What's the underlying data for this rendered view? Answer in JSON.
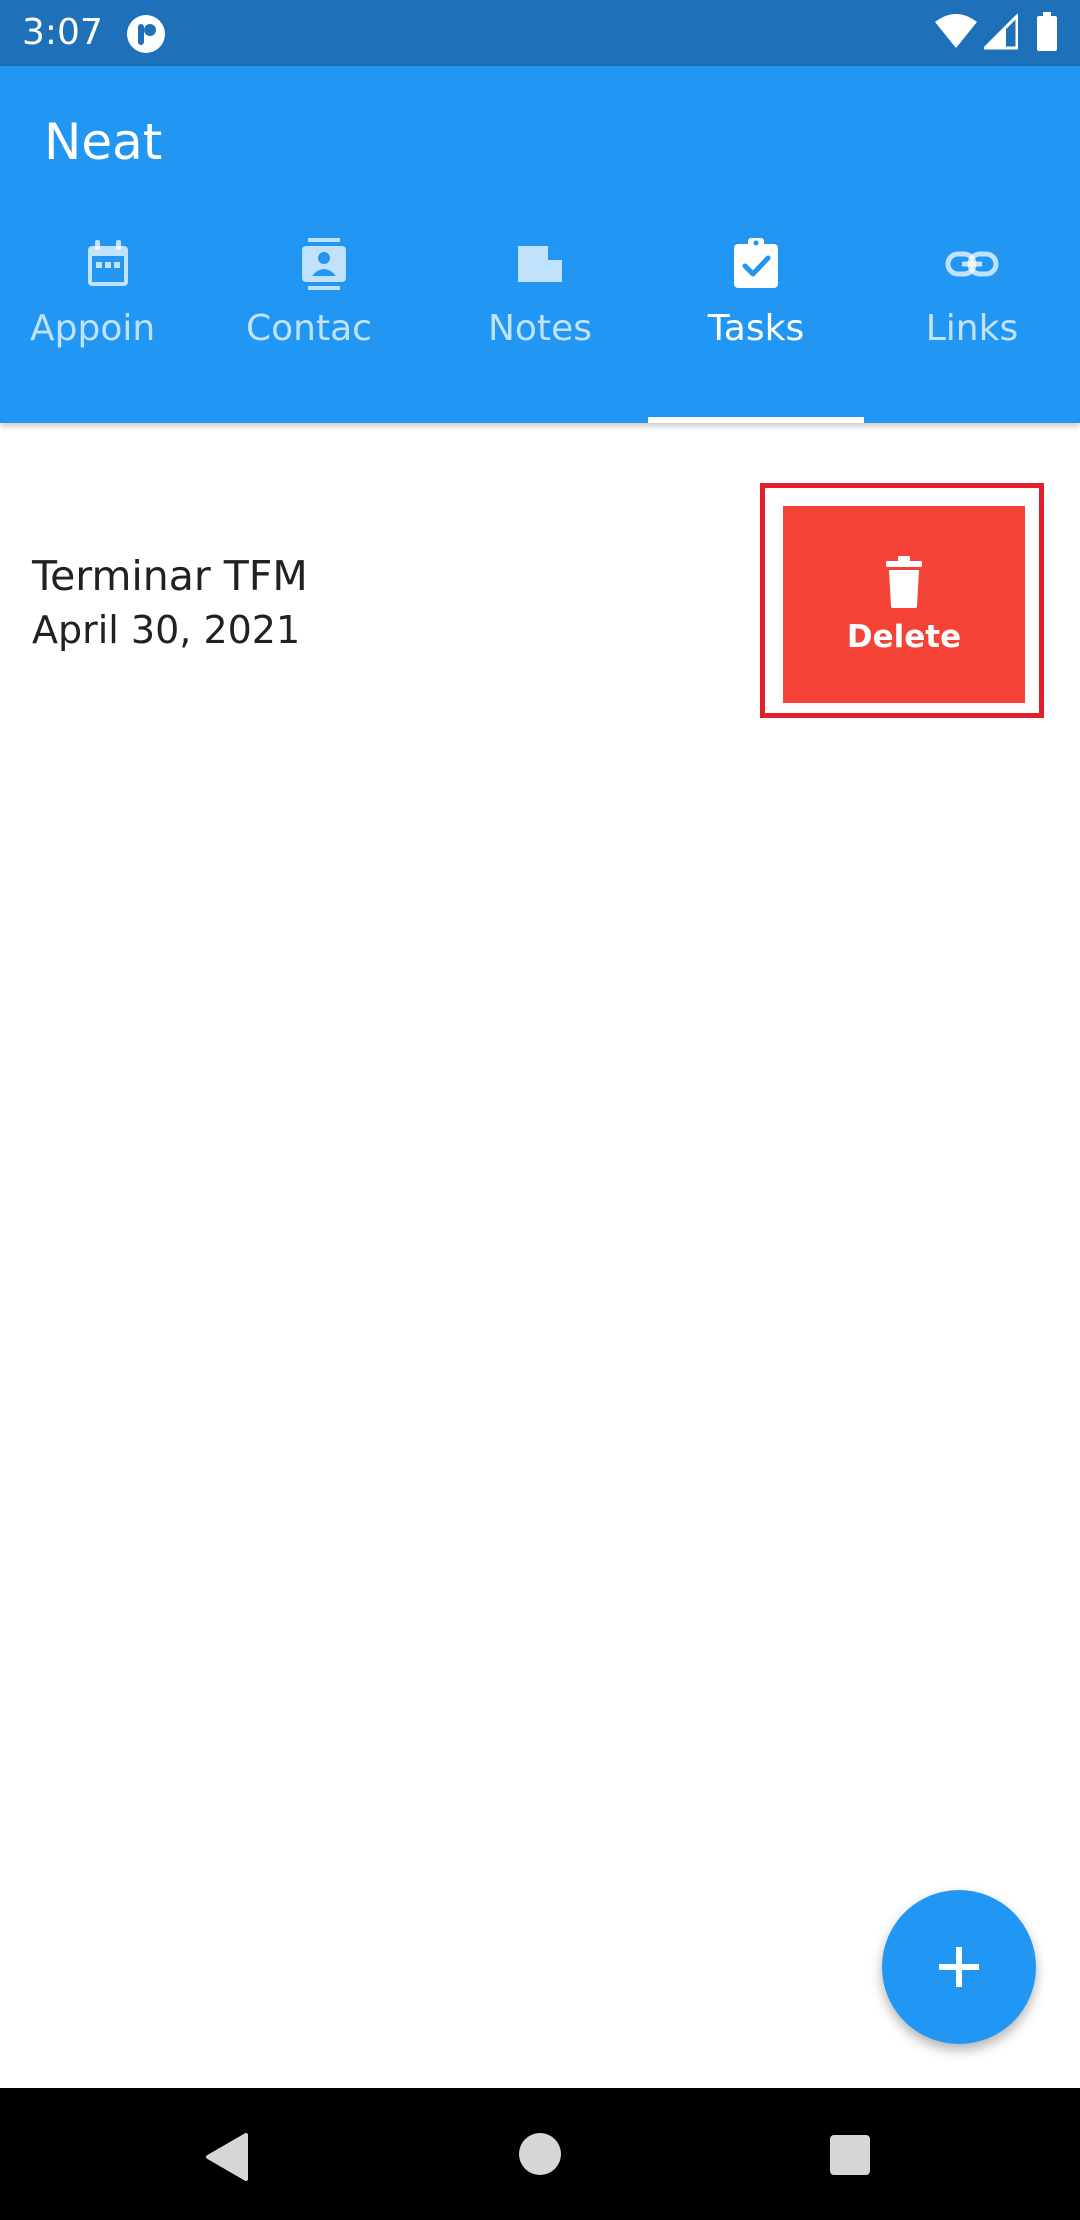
{
  "status_bar": {
    "time": "3:07",
    "app_icon": "notification-app-icon",
    "icons": [
      "wifi-icon",
      "signal-icon",
      "battery-icon"
    ]
  },
  "app_bar": {
    "title": "Neat",
    "color": "#2196f3"
  },
  "tabs": [
    {
      "label": "Appoin",
      "icon": "calendar-icon",
      "selected": false
    },
    {
      "label": "Contac",
      "icon": "contacts-icon",
      "selected": false
    },
    {
      "label": "Notes",
      "icon": "note-icon",
      "selected": false
    },
    {
      "label": "Tasks",
      "icon": "clipboard-check-icon",
      "selected": true
    },
    {
      "label": "Links",
      "icon": "link-icon",
      "selected": false
    }
  ],
  "tasks": [
    {
      "title": "Terminar TFM",
      "date": "April 30, 2021"
    }
  ],
  "swipe_action": {
    "label": "Delete",
    "icon": "trash-icon",
    "color": "#f44336",
    "highlight_color": "#e0202c"
  },
  "fab": {
    "icon": "plus-icon"
  },
  "nav_bar": {
    "icons": [
      "back-icon",
      "home-icon",
      "recents-icon"
    ]
  }
}
